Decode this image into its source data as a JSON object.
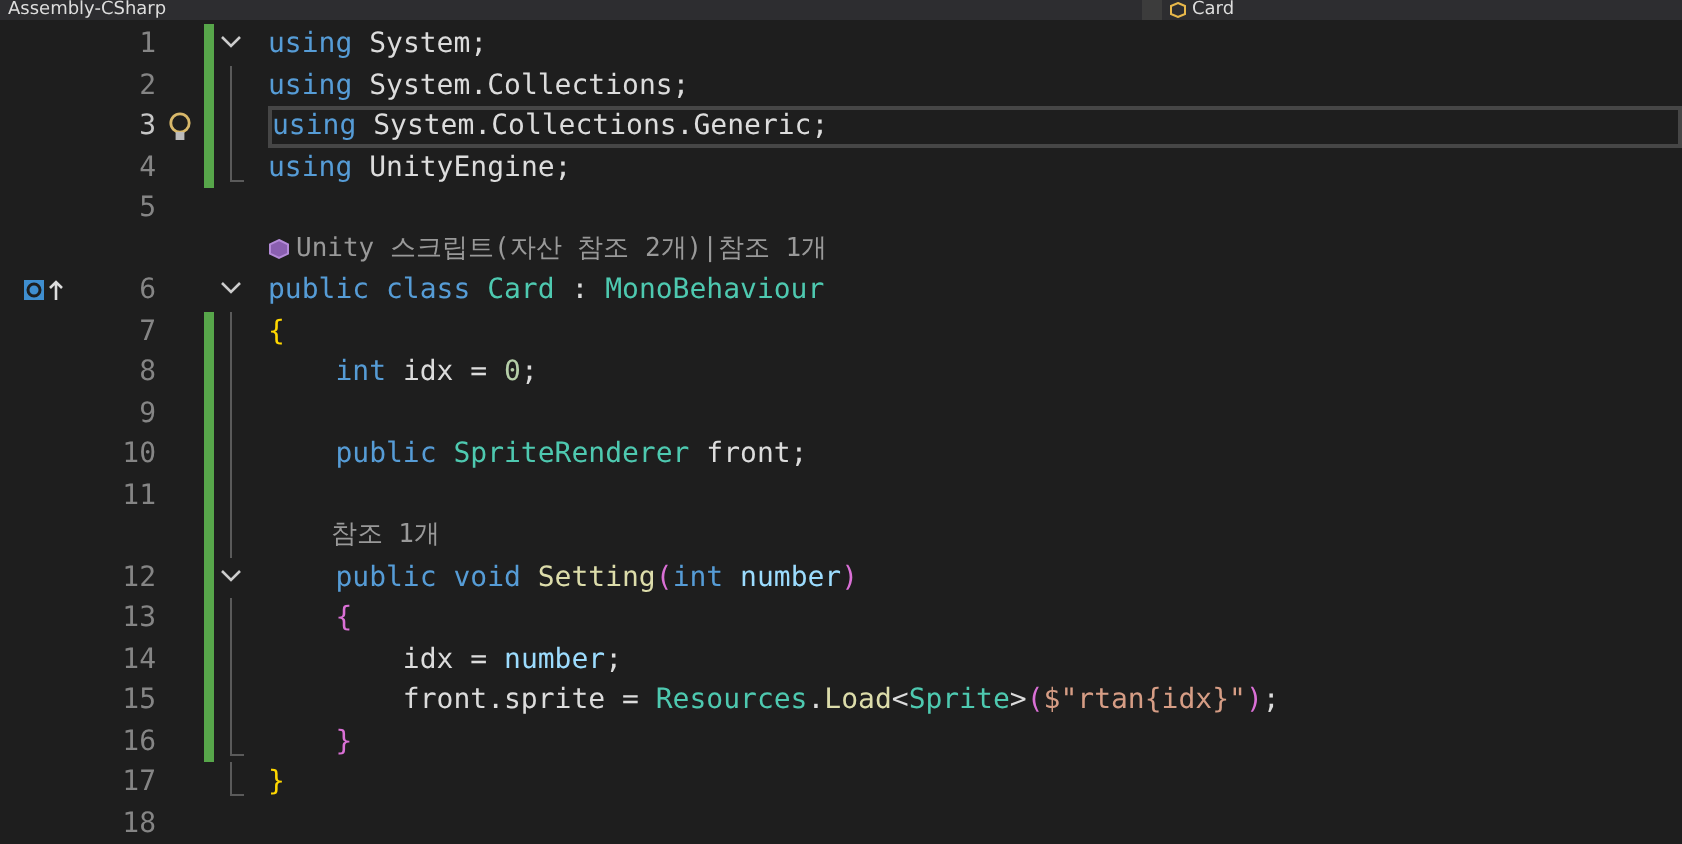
{
  "top_bar": {
    "project_dropdown": "Assembly-CSharp",
    "member_dropdown": "Card"
  },
  "rows": [
    {
      "kind": "code",
      "number": "1",
      "modified": true,
      "current": false,
      "fold": {
        "kind": "start",
        "expanded": true
      },
      "tokens": [
        {
          "kind": "keyword",
          "text": "using"
        },
        {
          "kind": "plain",
          "text": " System;"
        }
      ]
    },
    {
      "kind": "code",
      "number": "2",
      "modified": true,
      "current": false,
      "fold": {
        "kind": "inside"
      },
      "tokens": [
        {
          "kind": "keyword",
          "text": "using"
        },
        {
          "kind": "plain",
          "text": " System.Collections;"
        }
      ]
    },
    {
      "kind": "code",
      "number": "3",
      "modified": true,
      "current": true,
      "lightbulb": true,
      "fold": {
        "kind": "inside"
      },
      "tokens": [
        {
          "kind": "keyword",
          "text": "using"
        },
        {
          "kind": "plain",
          "text": " System.Collections.Generic;"
        }
      ]
    },
    {
      "kind": "code",
      "number": "4",
      "modified": true,
      "current": false,
      "fold": {
        "kind": "end"
      },
      "tokens": [
        {
          "kind": "keyword",
          "text": "using"
        },
        {
          "kind": "plain",
          "text": " UnityEngine;"
        }
      ]
    },
    {
      "kind": "code",
      "number": "5",
      "modified": false,
      "current": false
    },
    {
      "kind": "lens",
      "icon": true,
      "text": "Unity 스크립트(자산 참조 2개)|참조 1개"
    },
    {
      "kind": "code",
      "number": "6",
      "modified": false,
      "current": false,
      "override": true,
      "fold": {
        "kind": "start",
        "expanded": true
      },
      "tokens": [
        {
          "kind": "keyword",
          "text": "public class "
        },
        {
          "kind": "type",
          "text": "Card"
        },
        {
          "kind": "plain",
          "text": " : "
        },
        {
          "kind": "type",
          "text": "MonoBehaviour"
        }
      ]
    },
    {
      "kind": "code",
      "number": "7",
      "modified": true,
      "current": false,
      "fold": {
        "kind": "inside"
      },
      "tokens": [
        {
          "kind": "brace",
          "text": "{"
        }
      ]
    },
    {
      "kind": "code",
      "number": "8",
      "modified": true,
      "current": false,
      "fold": {
        "kind": "inside"
      },
      "tokens": [
        {
          "kind": "keyword",
          "text": "    int"
        },
        {
          "kind": "plain",
          "text": " idx = "
        },
        {
          "kind": "number",
          "text": "0"
        },
        {
          "kind": "plain",
          "text": ";"
        }
      ]
    },
    {
      "kind": "code",
      "number": "9",
      "modified": true,
      "current": false,
      "fold": {
        "kind": "inside"
      }
    },
    {
      "kind": "code",
      "number": "10",
      "modified": true,
      "current": false,
      "fold": {
        "kind": "inside"
      },
      "tokens": [
        {
          "kind": "keyword",
          "text": "    public "
        },
        {
          "kind": "type",
          "text": "SpriteRenderer"
        },
        {
          "kind": "plain",
          "text": " front;"
        }
      ]
    },
    {
      "kind": "code",
      "number": "11",
      "modified": true,
      "current": false,
      "fold": {
        "kind": "inside"
      }
    },
    {
      "kind": "lens",
      "icon": false,
      "text": "    참조 1개",
      "modified": true,
      "fold": {
        "kind": "inside"
      }
    },
    {
      "kind": "code",
      "number": "12",
      "modified": true,
      "current": false,
      "fold": {
        "kind": "start",
        "expanded": true
      },
      "tokens": [
        {
          "kind": "keyword",
          "text": "    public void "
        },
        {
          "kind": "method",
          "text": "Setting"
        },
        {
          "kind": "paren",
          "text": "("
        },
        {
          "kind": "keyword",
          "text": "int "
        },
        {
          "kind": "param",
          "text": "number"
        },
        {
          "kind": "paren",
          "text": ")"
        }
      ]
    },
    {
      "kind": "code",
      "number": "13",
      "modified": true,
      "current": false,
      "fold": {
        "kind": "inside"
      },
      "tokens": [
        {
          "kind": "paren",
          "text": "    {"
        }
      ]
    },
    {
      "kind": "code",
      "number": "14",
      "modified": true,
      "current": false,
      "fold": {
        "kind": "inside"
      },
      "tokens": [
        {
          "kind": "plain",
          "text": "        idx = "
        },
        {
          "kind": "param",
          "text": "number"
        },
        {
          "kind": "plain",
          "text": ";"
        }
      ]
    },
    {
      "kind": "code",
      "number": "15",
      "modified": true,
      "current": false,
      "fold": {
        "kind": "inside"
      },
      "tokens": [
        {
          "kind": "plain",
          "text": "        front.sprite = "
        },
        {
          "kind": "type",
          "text": "Resources"
        },
        {
          "kind": "plain",
          "text": "."
        },
        {
          "kind": "method",
          "text": "Load"
        },
        {
          "kind": "plain",
          "text": "<"
        },
        {
          "kind": "type",
          "text": "Sprite"
        },
        {
          "kind": "plain",
          "text": ">"
        },
        {
          "kind": "paren",
          "text": "("
        },
        {
          "kind": "string",
          "text": "$\"rtan{idx}\""
        },
        {
          "kind": "paren",
          "text": ")"
        },
        {
          "kind": "plain",
          "text": ";"
        }
      ]
    },
    {
      "kind": "code",
      "number": "16",
      "modified": true,
      "current": false,
      "fold": {
        "kind": "end"
      },
      "tokens": [
        {
          "kind": "paren",
          "text": "    }"
        }
      ]
    },
    {
      "kind": "code",
      "number": "17",
      "modified": false,
      "current": false,
      "fold": {
        "kind": "end"
      },
      "tokens": [
        {
          "kind": "brace",
          "text": "}"
        }
      ]
    },
    {
      "kind": "code",
      "number": "18",
      "modified": false,
      "current": false
    }
  ]
}
